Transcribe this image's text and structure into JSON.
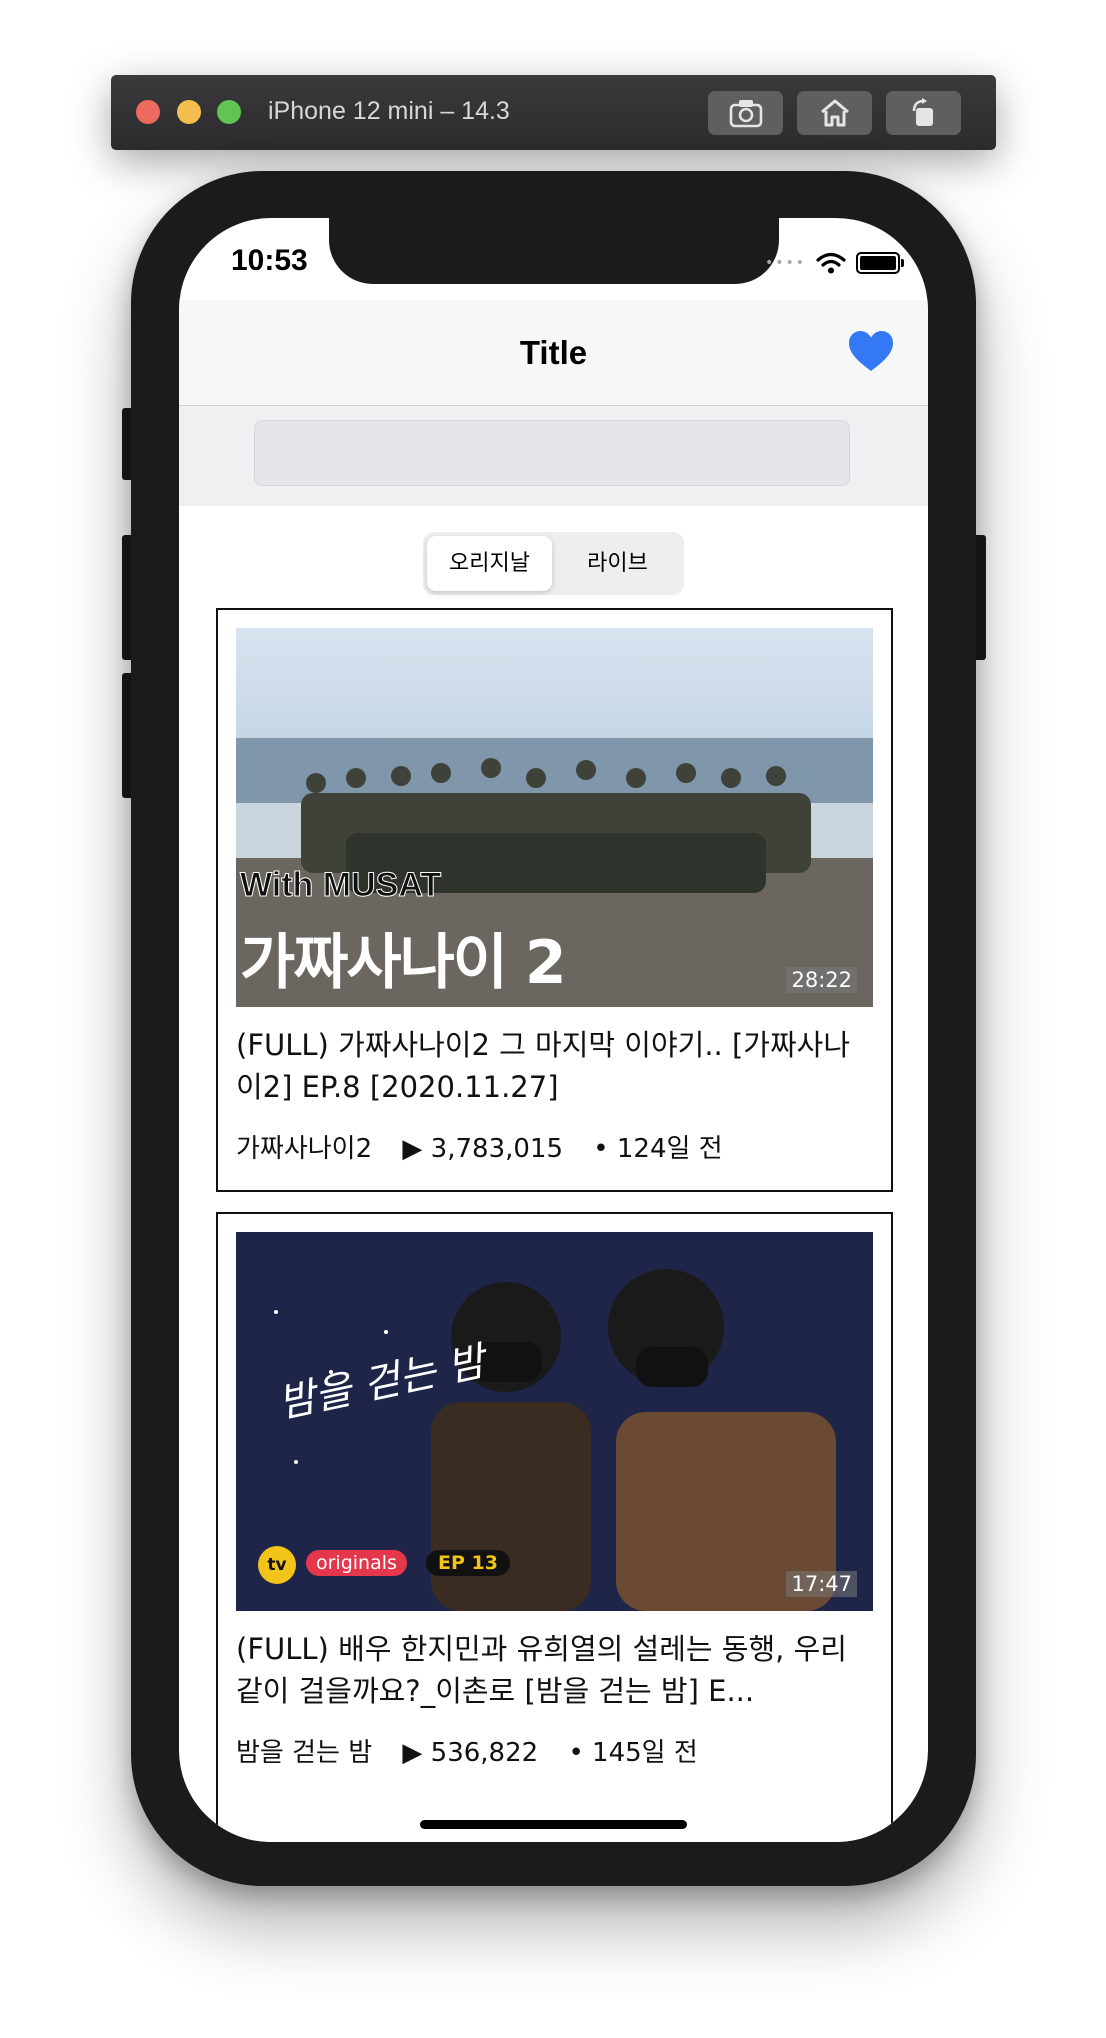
{
  "simulator": {
    "title": "iPhone 12 mini – 14.3",
    "buttons": [
      "screenshot-icon",
      "home-icon",
      "rotate-icon"
    ]
  },
  "status_bar": {
    "time": "10:53",
    "icons": [
      "wifi-icon",
      "battery-icon"
    ]
  },
  "navbar": {
    "title": "Title",
    "favorite_icon": "heart-icon",
    "favorite_color": "#3478f6"
  },
  "search": {
    "value": ""
  },
  "segments": {
    "items": [
      "오리지날",
      "라이브"
    ],
    "selected": 0
  },
  "videos": [
    {
      "duration": "28:22",
      "title": "(FULL) 가짜사나이2 그 마지막 이야기.. [가짜사나이2] EP.8 [2020.11.27]",
      "channel": "가짜사나이2",
      "views": "▶ 3,783,015",
      "age": "• 124일 전",
      "thumbnail_text": {
        "line1": "With MUSAT",
        "line2": "가짜사나이 2"
      }
    },
    {
      "duration": "17:47",
      "title": "(FULL) 배우 한지민과 유희열의 설레는 동행, 우리 같이 걸을까요?_이촌로 [밤을 걷는 밤] E...",
      "channel": "밤을 걷는 밤",
      "views": "▶ 536,822",
      "age": "• 145일 전",
      "thumbnail_text": {
        "logo": "밤을 걷는 밤",
        "badge": "originals",
        "episode": "EP 13",
        "tv": "tv"
      }
    }
  ]
}
